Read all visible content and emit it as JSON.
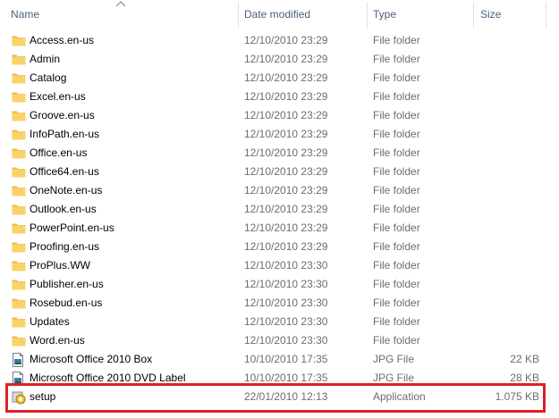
{
  "columns": {
    "name": "Name",
    "date": "Date modified",
    "type": "Type",
    "size": "Size"
  },
  "files": [
    {
      "name": "Access.en-us",
      "date": "12/10/2010 23:29",
      "type": "File folder",
      "size": "",
      "icon": "folder-icon"
    },
    {
      "name": "Admin",
      "date": "12/10/2010 23:29",
      "type": "File folder",
      "size": "",
      "icon": "folder-icon"
    },
    {
      "name": "Catalog",
      "date": "12/10/2010 23:29",
      "type": "File folder",
      "size": "",
      "icon": "folder-icon"
    },
    {
      "name": "Excel.en-us",
      "date": "12/10/2010 23:29",
      "type": "File folder",
      "size": "",
      "icon": "folder-icon"
    },
    {
      "name": "Groove.en-us",
      "date": "12/10/2010 23:29",
      "type": "File folder",
      "size": "",
      "icon": "folder-icon"
    },
    {
      "name": "InfoPath.en-us",
      "date": "12/10/2010 23:29",
      "type": "File folder",
      "size": "",
      "icon": "folder-icon"
    },
    {
      "name": "Office.en-us",
      "date": "12/10/2010 23:29",
      "type": "File folder",
      "size": "",
      "icon": "folder-icon"
    },
    {
      "name": "Office64.en-us",
      "date": "12/10/2010 23:29",
      "type": "File folder",
      "size": "",
      "icon": "folder-icon"
    },
    {
      "name": "OneNote.en-us",
      "date": "12/10/2010 23:29",
      "type": "File folder",
      "size": "",
      "icon": "folder-icon"
    },
    {
      "name": "Outlook.en-us",
      "date": "12/10/2010 23:29",
      "type": "File folder",
      "size": "",
      "icon": "folder-icon"
    },
    {
      "name": "PowerPoint.en-us",
      "date": "12/10/2010 23:29",
      "type": "File folder",
      "size": "",
      "icon": "folder-icon"
    },
    {
      "name": "Proofing.en-us",
      "date": "12/10/2010 23:29",
      "type": "File folder",
      "size": "",
      "icon": "folder-icon"
    },
    {
      "name": "ProPlus.WW",
      "date": "12/10/2010 23:30",
      "type": "File folder",
      "size": "",
      "icon": "folder-icon"
    },
    {
      "name": "Publisher.en-us",
      "date": "12/10/2010 23:30",
      "type": "File folder",
      "size": "",
      "icon": "folder-icon"
    },
    {
      "name": "Rosebud.en-us",
      "date": "12/10/2010 23:30",
      "type": "File folder",
      "size": "",
      "icon": "folder-icon"
    },
    {
      "name": "Updates",
      "date": "12/10/2010 23:30",
      "type": "File folder",
      "size": "",
      "icon": "folder-icon"
    },
    {
      "name": "Word.en-us",
      "date": "12/10/2010 23:30",
      "type": "File folder",
      "size": "",
      "icon": "folder-icon"
    },
    {
      "name": "Microsoft Office 2010 Box",
      "date": "10/10/2010 17:35",
      "type": "JPG File",
      "size": "22 KB",
      "icon": "image-file-icon"
    },
    {
      "name": "Microsoft Office 2010 DVD Label",
      "date": "10/10/2010 17:35",
      "type": "JPG File",
      "size": "28 KB",
      "icon": "image-file-icon"
    },
    {
      "name": "setup",
      "date": "22/01/2010 12:13",
      "type": "Application",
      "size": "1.075 KB",
      "icon": "setup-app-icon"
    }
  ],
  "colors": {
    "header_text": "#4d6082",
    "highlight_border": "#e01f26",
    "folder_yellow": "#f8d36a"
  }
}
